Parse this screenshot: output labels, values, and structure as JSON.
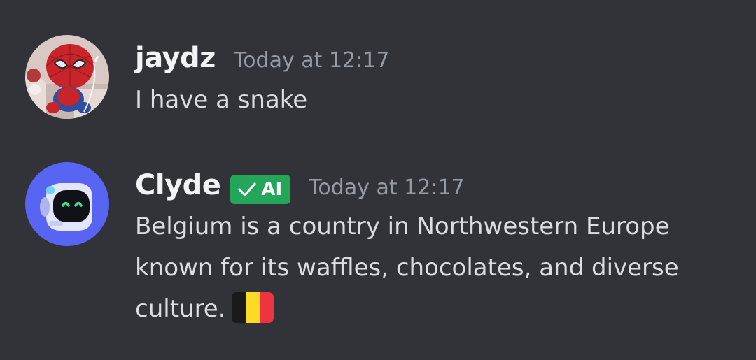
{
  "messages": [
    {
      "username": "jaydz",
      "timestamp": "Today at 12:17",
      "text": "I have a snake",
      "avatar_icon": "spiderman-plush-avatar"
    },
    {
      "username": "Clyde",
      "badge": {
        "label": "AI",
        "icon": "check-icon",
        "color": "#23a55a"
      },
      "timestamp": "Today at 12:17",
      "lines": [
        "Belgium is a country in Northwestern Europe",
        "known for its waffles, chocolates, and diverse",
        "culture."
      ],
      "emoji": "belgium-flag",
      "avatar_icon": "clyde-robot-avatar"
    }
  ],
  "colors": {
    "background": "#313338",
    "username": "#f2f3f5",
    "timestamp": "#949ba4",
    "message_text": "#dbdee1",
    "clyde_avatar_bg": "#5865f2"
  }
}
